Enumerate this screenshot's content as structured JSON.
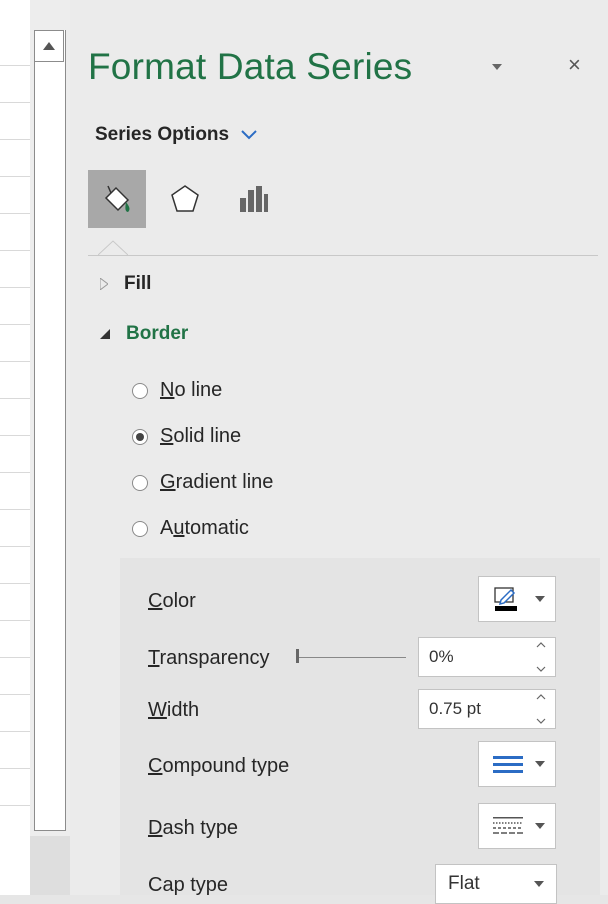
{
  "pane": {
    "title": "Format Data Series",
    "title_dropdown_icon": "caret-down-icon",
    "close_label": "×",
    "series_options_label": "Series Options",
    "series_options_chevron": "⌄"
  },
  "tabs": [
    {
      "name": "fill-line-tab",
      "icon": "paint-bucket-icon",
      "active": true
    },
    {
      "name": "effects-tab",
      "icon": "pentagon-icon",
      "active": false
    },
    {
      "name": "series-options-tab",
      "icon": "bar-chart-icon",
      "active": false
    }
  ],
  "sections": {
    "fill": {
      "label": "Fill",
      "expanded": false
    },
    "border": {
      "label": "Border",
      "expanded": true
    }
  },
  "border_options": [
    {
      "pre": "",
      "mn": "N",
      "post": "o line",
      "selected": false
    },
    {
      "pre": "",
      "mn": "S",
      "post": "olid line",
      "selected": true
    },
    {
      "pre": "",
      "mn": "G",
      "post": "radient line",
      "selected": false
    },
    {
      "pre": "A",
      "mn": "u",
      "post": "tomatic",
      "selected": false
    }
  ],
  "properties": {
    "color": {
      "pre": "",
      "mn": "C",
      "post": "olor",
      "swatch": "#000000"
    },
    "transparency": {
      "pre": "",
      "mn": "T",
      "post": "ransparency",
      "value": "0%",
      "level_percent": 0
    },
    "width": {
      "pre": "",
      "mn": "W",
      "post": "idth",
      "value": "0.75 pt"
    },
    "compound": {
      "pre": "",
      "mn": "C",
      "post": "ompound type"
    },
    "dash": {
      "pre": "",
      "mn": "D",
      "post": "ash type"
    },
    "cap": {
      "label": "Cap type",
      "value": "Flat"
    }
  },
  "colors": {
    "accent": "#217346",
    "compound_blue": "#2b6cc4"
  }
}
